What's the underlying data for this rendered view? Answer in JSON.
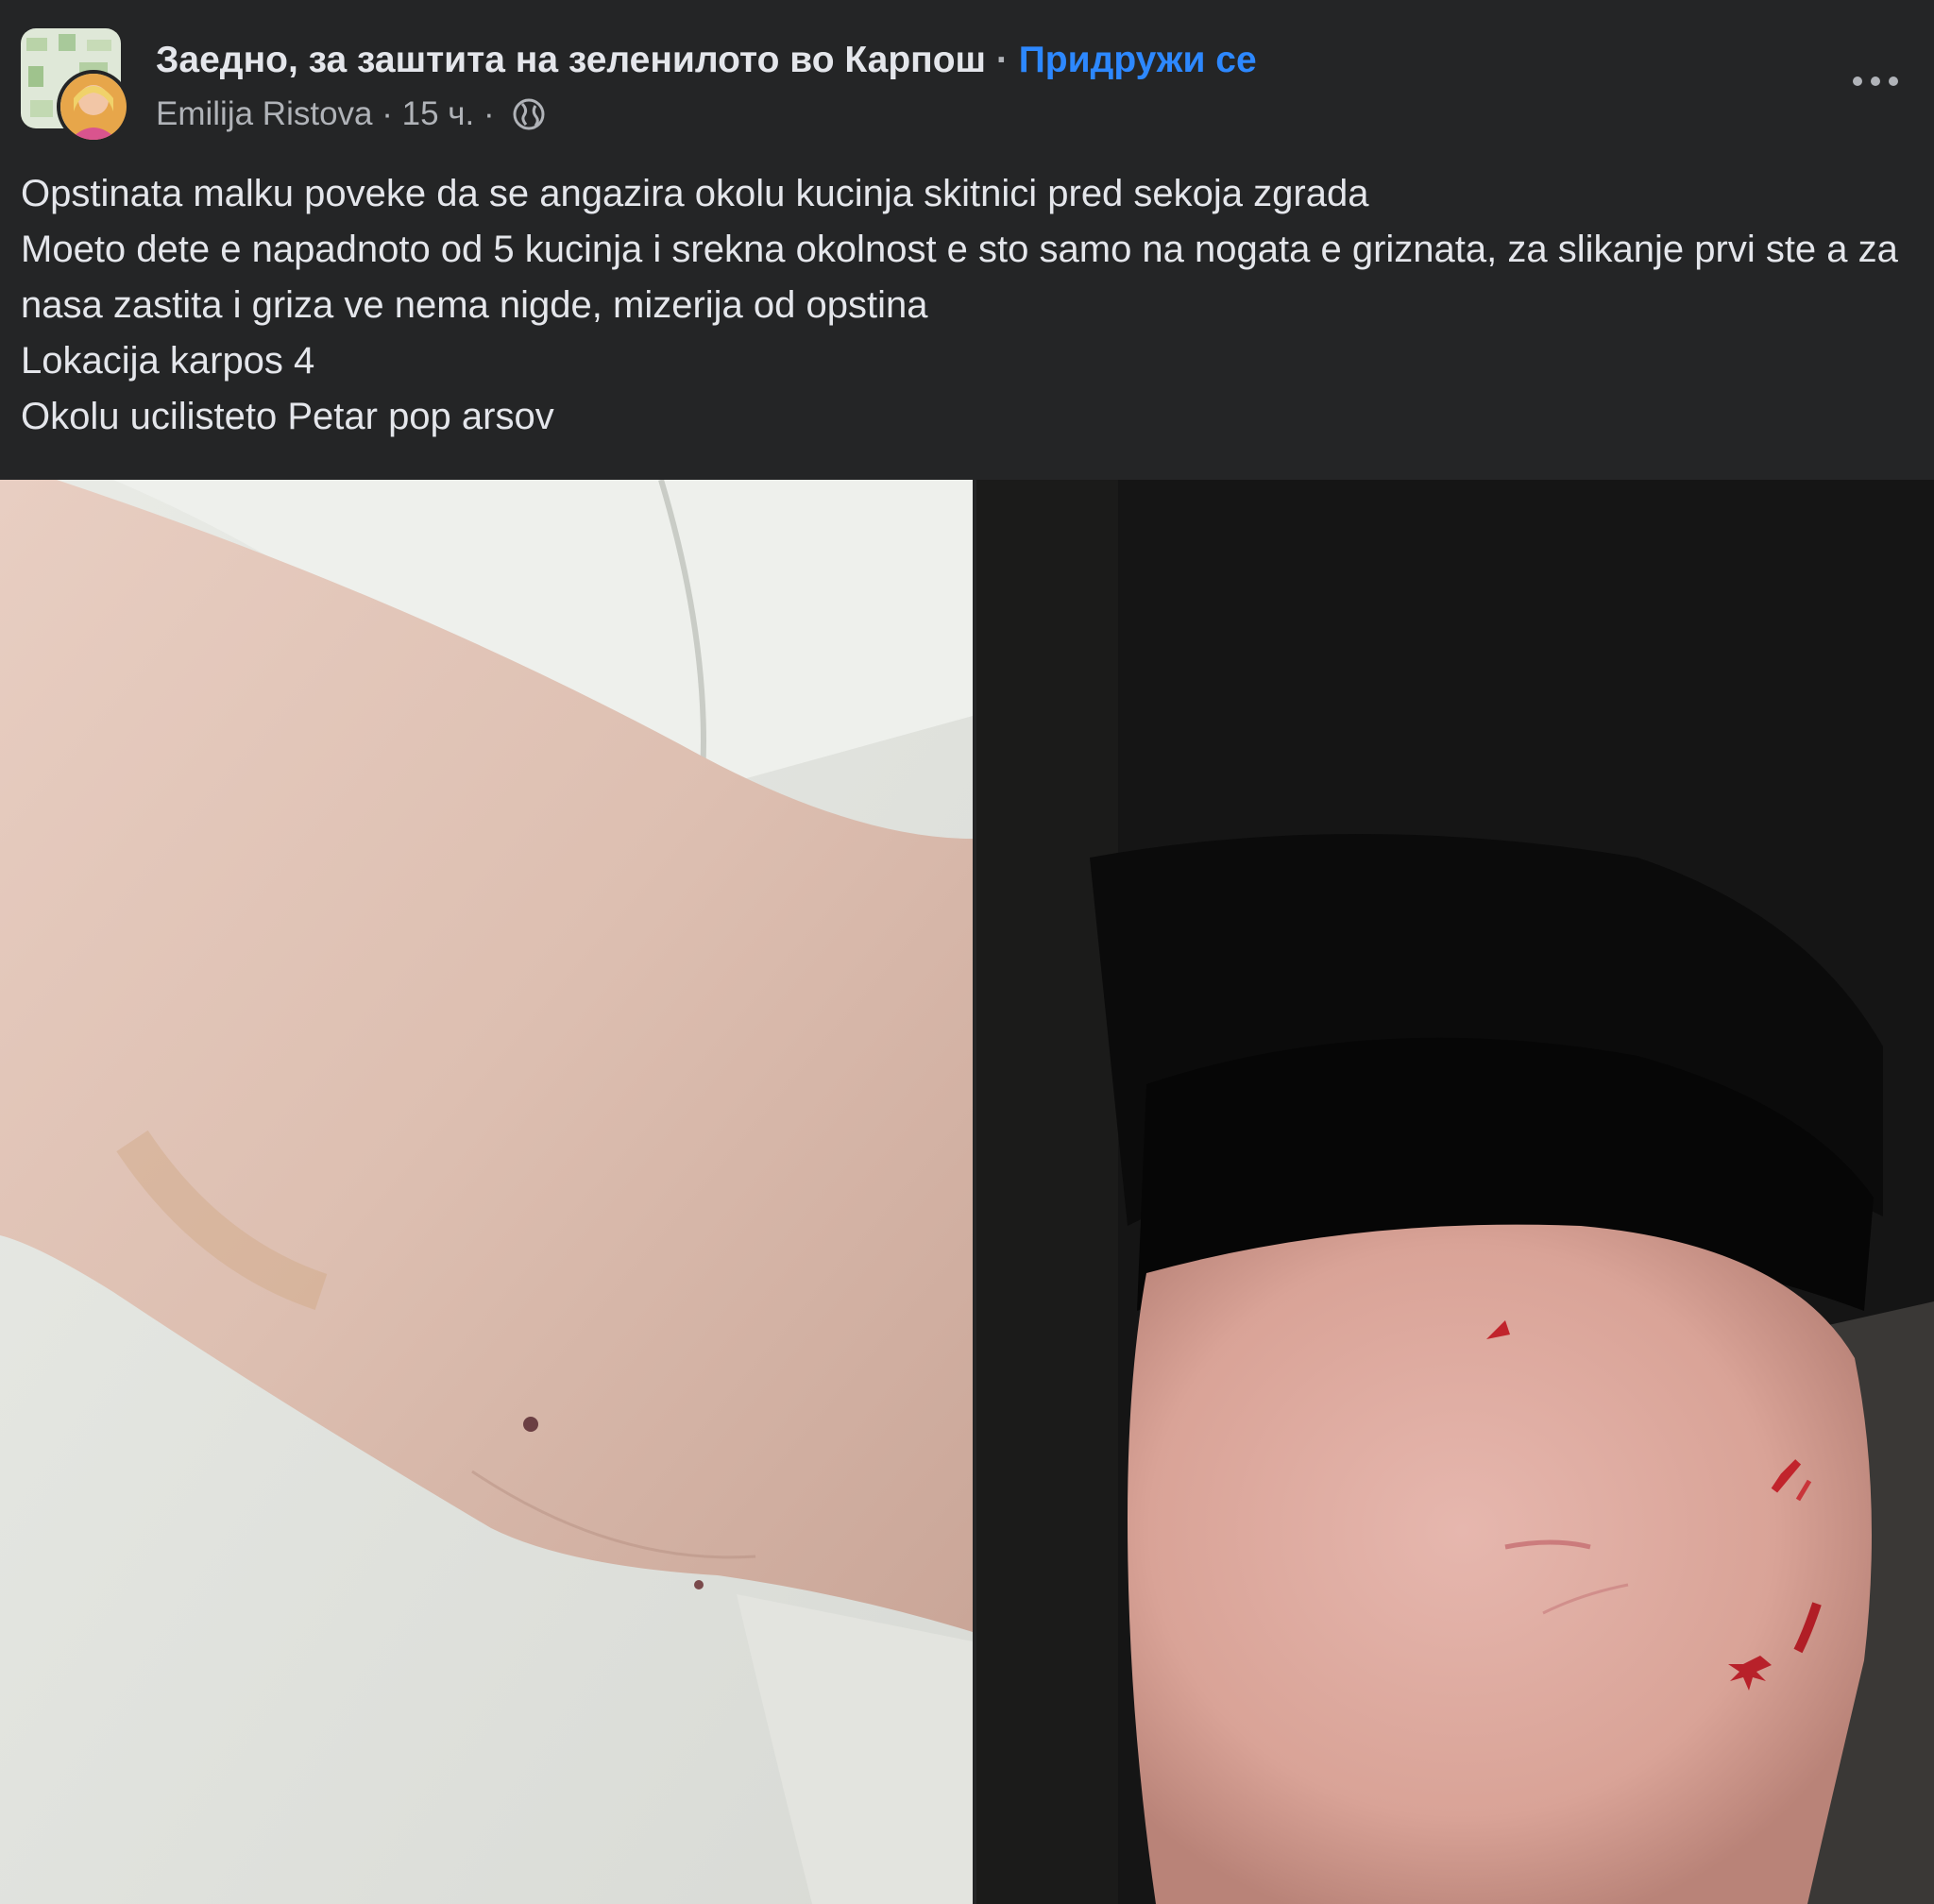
{
  "header": {
    "group_name": "Заедно, за заштита на зеленилото во Карпош",
    "separator": " · ",
    "join_label": "Придружи се",
    "author": "Emilija Ristova",
    "meta_sep1": " · ",
    "time": "15 ч.",
    "meta_sep2": " · ",
    "privacy_icon": "globe-icon",
    "more_icon": "more-options-icon"
  },
  "post": {
    "lines": [
      "Opstinata malku poveke da se angazira okolu kucinja skitnici pred sekoja zgrada",
      "Moeto dete e napadnoto od 5 kucinja i srekna okolnost e sto samo na nogata e griznata, za slikanje prvi ste a za nasa zastita i griza ve nema nigde, mizerija od opstina",
      "Lokacija karpos 4",
      "Okolu ucilisteto Petar pop arsov"
    ]
  },
  "colors": {
    "background": "#242526",
    "primary_text": "#e4e6eb",
    "secondary_text": "#b0b3b8",
    "link": "#2d88ff"
  }
}
